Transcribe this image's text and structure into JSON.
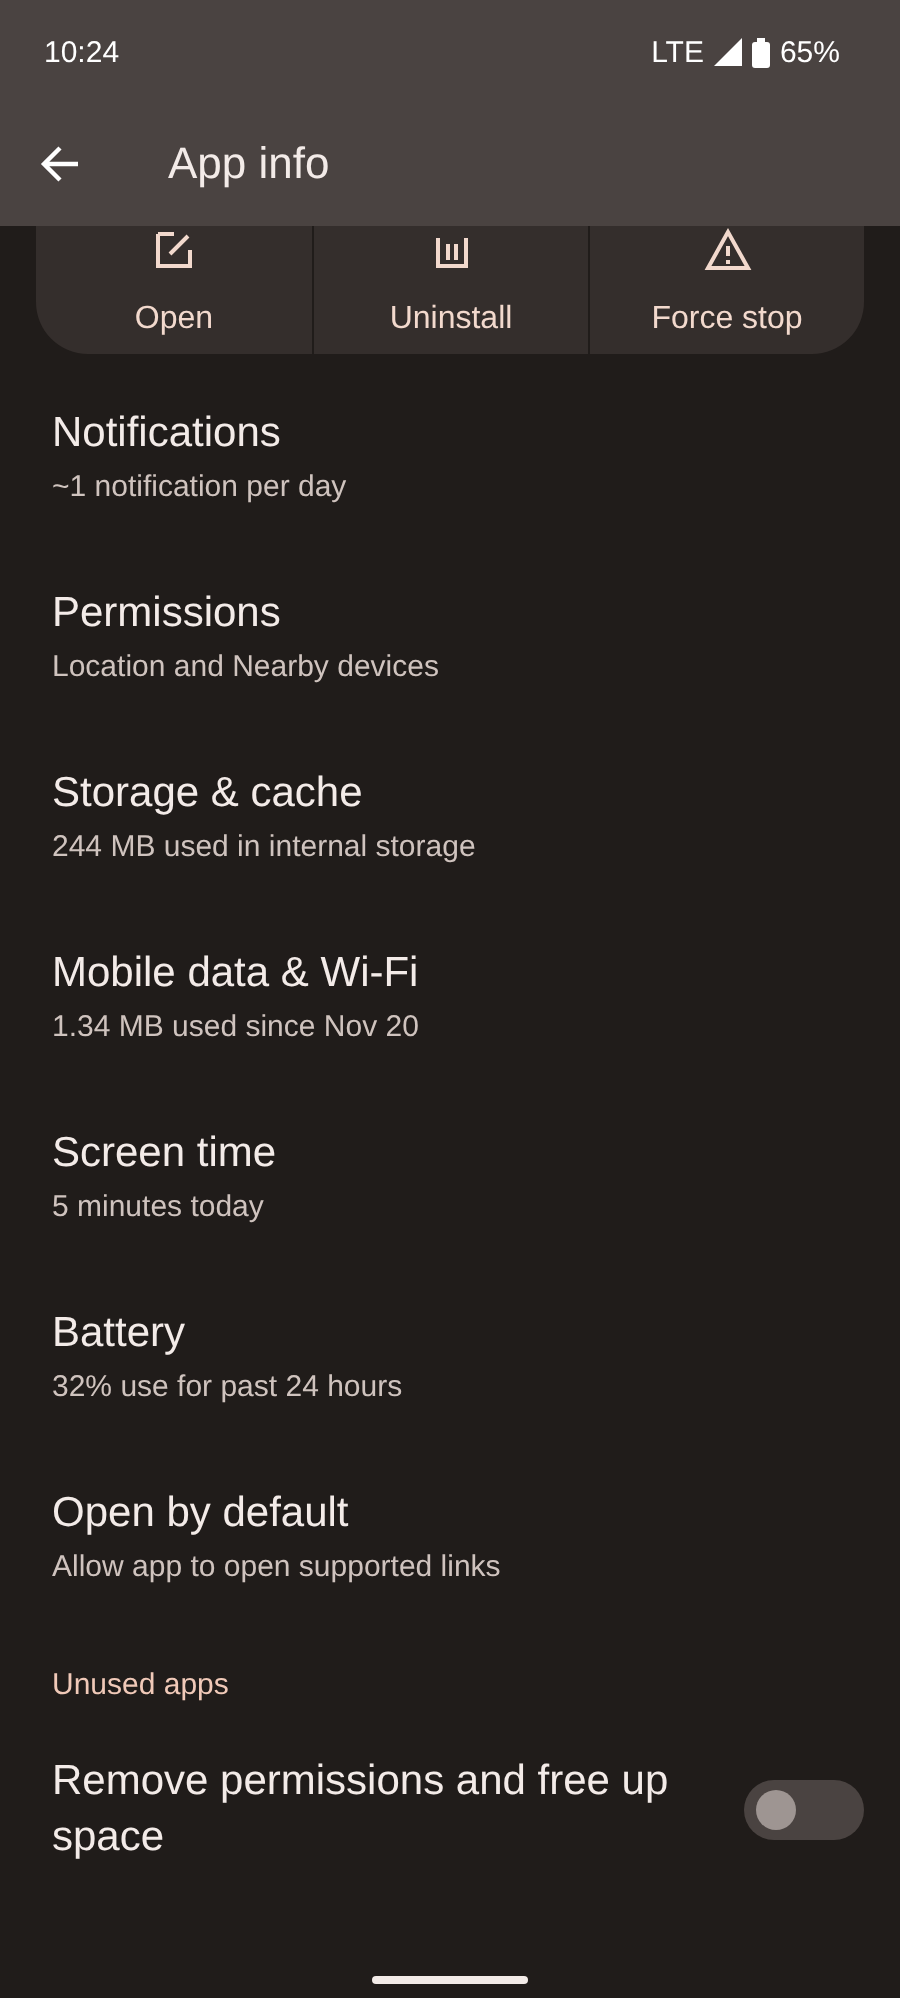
{
  "status_bar": {
    "time": "10:24",
    "network": "LTE",
    "battery": "65%"
  },
  "app_bar": {
    "title": "App info"
  },
  "actions": [
    {
      "label": "Open",
      "kind": "open"
    },
    {
      "label": "Uninstall",
      "kind": "uninstall"
    },
    {
      "label": "Force stop",
      "kind": "stop"
    }
  ],
  "items": [
    {
      "title": "Notifications",
      "summary": "~1 notification per day"
    },
    {
      "title": "Permissions",
      "summary": "Location and Nearby devices"
    },
    {
      "title": "Storage & cache",
      "summary": "244 MB used in internal storage"
    },
    {
      "title": "Mobile data & Wi-Fi",
      "summary": "1.34 MB used since Nov 20"
    },
    {
      "title": "Screen time",
      "summary": "5 minutes today"
    },
    {
      "title": "Battery",
      "summary": "32% use for past 24 hours"
    },
    {
      "title": "Open by default",
      "summary": "Allow app to open supported links"
    }
  ],
  "section": {
    "title": "Unused apps"
  },
  "toggle_item": {
    "title": "Remove permissions and free up space",
    "on": false
  }
}
